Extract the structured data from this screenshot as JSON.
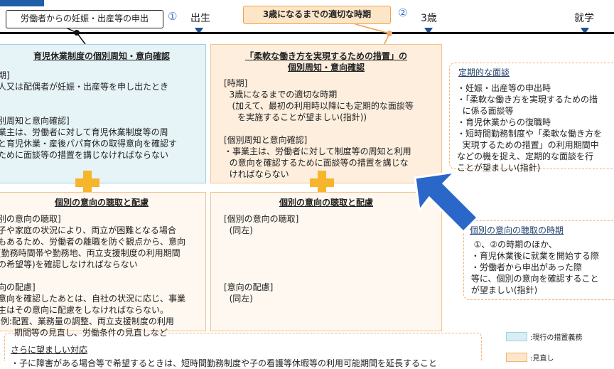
{
  "header": {
    "tab_label": "",
    "request_label": "労働者からの妊娠・出産等の申出",
    "marker_1": "①",
    "marker_2": "②",
    "birth": "出生",
    "age3": "3歳",
    "school": "就学",
    "period_label": "3歳になるまでの適切な時期"
  },
  "left_top": {
    "title": "育児休業制度の個別周知・意向確認",
    "lines": [
      "期]",
      "人又は配偶者が妊娠・出産等を申し出たとき",
      "",
      "",
      "別周知と意向確認]",
      "業主は、労働者に対して育児休業制度等の周",
      "と育児休業・産後パパ育休の取得意向を確認す",
      "ために面談等の措置を講じなければならない"
    ]
  },
  "mid_top": {
    "title_1": "「柔軟な働き方を実現するための措置」の",
    "title_2": "個別周知・意向確認",
    "lines": [
      "[時期]",
      "  3歳になるまでの適切な時期",
      "   (加えて、最初の利用時以降にも定期的な面談等",
      "     を実施することが望ましい(指針))",
      "",
      "[個別周知と意向確認]",
      "・事業主は、労働者に対して制度等の周知と利用",
      "  の意向を確認するために面談等の措置を講じな",
      "  ければならない"
    ]
  },
  "left_bottom": {
    "title": "個別の意向の聴取と配慮",
    "lines": [
      "別の意向の聴取]",
      "子や家庭の状況により、両立が困難となる場合",
      "もあるため、労働者の離職を防ぐ観点から、意向",
      "(勤務時間帯や勤務地、両立支援制度の利用期間",
      "の希望等)を確認しなければならない",
      "",
      "向の配慮]",
      "意向を確認したあとは、自社の状況に応じ、事業",
      "主はその意向に配慮をしなければならない。",
      " 例:配置、業務量の調整、両立支援制度の利用",
      "      期間等の見直し、労働条件の見直しなど"
    ]
  },
  "mid_bottom": {
    "title": "個別の意向の聴取と配慮",
    "lines": [
      "[個別の意向の聴取]",
      "  (同左)",
      "",
      "",
      "",
      "",
      "[意向の配慮]",
      "  (同左)"
    ]
  },
  "right_top": {
    "title": "定期的な面談",
    "lines": [
      "・妊娠・出産等の申出時",
      "・「柔軟な働き方を実現するための措",
      "  に係る面談等",
      "・育児休業からの復職時",
      "・短時間勤務制度や「柔軟な働き方を",
      "  実現するための措置」の利用期間中",
      "などの機を捉え、定期的な面談を行",
      "ことが望ましい(指針)"
    ]
  },
  "right_bottom": {
    "title": "個別の意向の聴取の時期",
    "lines": [
      "  ①、②の時期のほか、",
      " ・育児休業後に就業を開始する際",
      " ・労働者から申出があった際",
      " 等に、個別の意向を確認すること",
      " が望ましい(指針)"
    ]
  },
  "footer": {
    "more_title": "さらに望ましい対応",
    "more_line": "・子に障害がある場合等で希望するときは、短時間勤務制度や子の看護等休暇等の利用可能期間を延長すること",
    "legend_blue": ":現行の措置義務",
    "legend_orange": ":見直し"
  },
  "colors": {
    "arrow": "#2a67c9",
    "plus": "#f7b52c",
    "timeline": "#111111"
  }
}
